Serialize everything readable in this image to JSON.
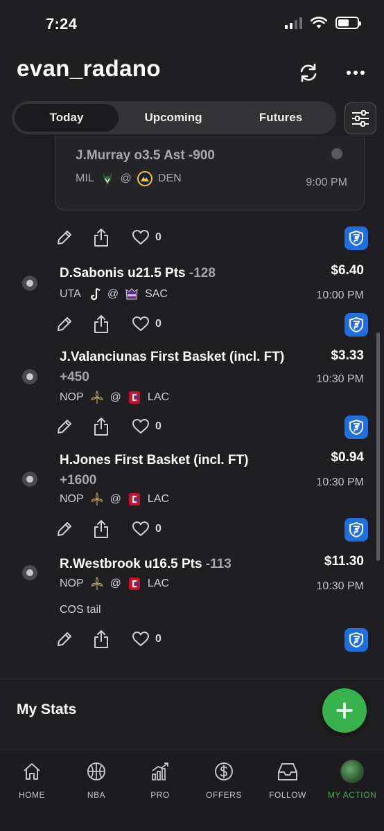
{
  "status_bar": {
    "time": "7:24"
  },
  "header": {
    "username": "evan_radano"
  },
  "tabs": [
    {
      "label": "Today",
      "active": true
    },
    {
      "label": "Upcoming",
      "active": false
    },
    {
      "label": "Futures",
      "active": false
    }
  ],
  "previous_bet": {
    "title": "J.Murray o3.5 Ast -900",
    "away": "MIL",
    "at": "@",
    "home": "DEN",
    "time": "9:00 PM",
    "likes": "0"
  },
  "bets": [
    {
      "title": "D.Sabonis u21.5 Pts",
      "odds": "-128",
      "amount": "$6.40",
      "away": "UTA",
      "at": "@",
      "home": "SAC",
      "time": "10:00 PM",
      "likes": "0",
      "note": ""
    },
    {
      "title": "J.Valanciunas First Basket (incl. FT)",
      "odds": "+450",
      "amount": "$3.33",
      "away": "NOP",
      "at": "@",
      "home": "LAC",
      "time": "10:30 PM",
      "likes": "0",
      "note": ""
    },
    {
      "title": "H.Jones First Basket (incl. FT)",
      "odds": "+1600",
      "amount": "$0.94",
      "away": "NOP",
      "at": "@",
      "home": "LAC",
      "time": "10:30 PM",
      "likes": "0",
      "note": ""
    },
    {
      "title": "R.Westbrook u16.5 Pts",
      "odds": "-113",
      "amount": "$11.30",
      "away": "NOP",
      "at": "@",
      "home": "LAC",
      "time": "10:30 PM",
      "likes": "0",
      "note": "COS tail"
    }
  ],
  "stats": {
    "title": "My Stats"
  },
  "tabbar": [
    {
      "label": "HOME",
      "icon": "home-icon",
      "active": false
    },
    {
      "label": "NBA",
      "icon": "basketball-icon",
      "active": false
    },
    {
      "label": "PRO",
      "icon": "chart-icon",
      "active": false
    },
    {
      "label": "OFFERS",
      "icon": "dollar-icon",
      "active": false
    },
    {
      "label": "FOLLOW",
      "icon": "inbox-icon",
      "active": false
    },
    {
      "label": "MY ACTION",
      "icon": "avatar",
      "active": true
    }
  ],
  "colors": {
    "accent": "#37b24d",
    "book": "#1f6fe0",
    "background": "#1f1f21"
  }
}
